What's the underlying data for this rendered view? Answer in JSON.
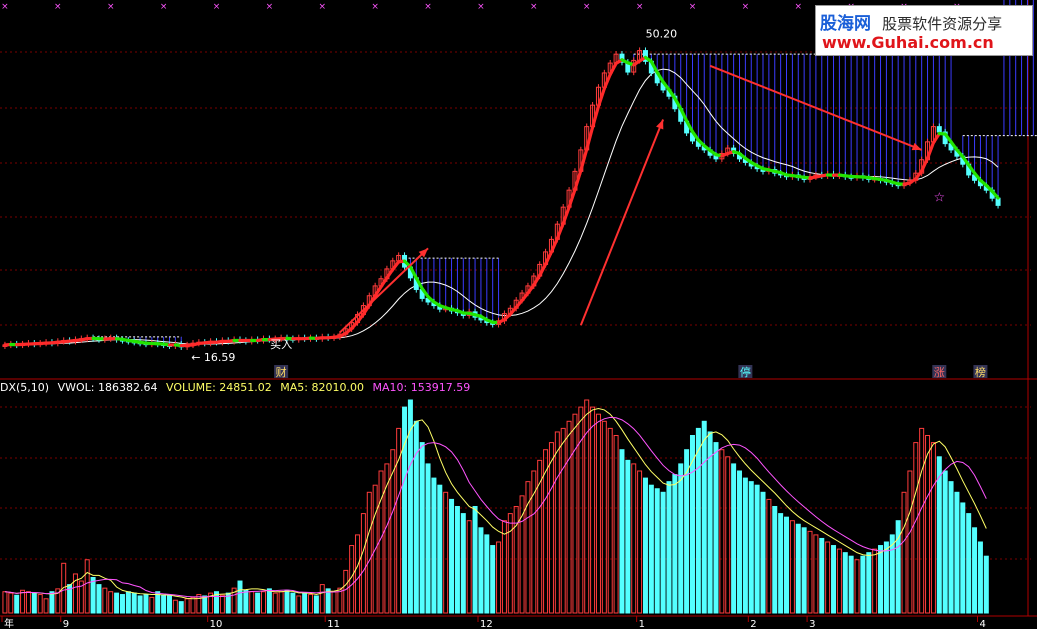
{
  "watermark": {
    "brand": "股海网",
    "subtitle": "股票软件资源分享",
    "url": "www.Guhai.com.cn"
  },
  "indicator_bar": {
    "name": "DX(5,10)",
    "vol_label": "VWOL:",
    "vol_value": "186382.64",
    "volume_label": "VOLUME:",
    "volume_value": "24851.02",
    "ma5_label": "MA5:",
    "ma5_value": "82010.00",
    "ma10_label": "MA10:",
    "ma10_value": "153917.59"
  },
  "colors": {
    "up": "#ff3c3c",
    "down": "#54ffff",
    "grid": "#7a0000",
    "ma_fast": "#ffffff",
    "ma_trend_up": "#ff2a2a",
    "ma_trend_down": "#22e400",
    "band": "#3b3bff",
    "vol_ma5": "#ffff66",
    "vol_ma10": "#ff55ff",
    "arrow": "#ff3030"
  },
  "chart_data": [
    {
      "type": "candlestick",
      "title": "",
      "y_labels": [
        "50.20",
        "16.59"
      ],
      "events": [
        {
          "label": "财",
          "index": 47
        },
        {
          "label": "停",
          "index": 126
        },
        {
          "label": "涨",
          "index": 159
        },
        {
          "label": "榜",
          "index": 166
        }
      ],
      "annotations": [
        {
          "label": "买入",
          "index": 47
        }
      ],
      "x_ticks": [
        "年",
        "9",
        "10",
        "11",
        "12",
        "1",
        "2",
        "3",
        "4"
      ],
      "x_tick_index": [
        0,
        10,
        35,
        55,
        81,
        108,
        127,
        137,
        166
      ],
      "closes": [
        16.8,
        16.9,
        16.8,
        16.9,
        17.0,
        16.9,
        17.0,
        17.1,
        17.0,
        17.2,
        17.3,
        17.2,
        17.4,
        17.5,
        17.6,
        17.5,
        17.4,
        17.5,
        17.6,
        17.4,
        17.3,
        17.2,
        17.1,
        17.0,
        16.9,
        17.0,
        16.9,
        16.8,
        16.7,
        16.9,
        16.59,
        16.8,
        17.0,
        17.1,
        17.0,
        17.2,
        17.1,
        17.3,
        17.2,
        17.4,
        17.3,
        17.2,
        17.4,
        17.3,
        17.5,
        17.4,
        17.5,
        17.6,
        17.5,
        17.4,
        17.6,
        17.5,
        17.6,
        17.5,
        17.7,
        17.6,
        17.7,
        18.0,
        18.6,
        19.3,
        20.2,
        21.2,
        22.3,
        23.4,
        24.2,
        25.3,
        26.2,
        26.8,
        25.5,
        24.3,
        23.0,
        22.0,
        21.6,
        21.2,
        20.8,
        20.9,
        20.6,
        20.4,
        20.1,
        20.5,
        19.9,
        19.6,
        19.3,
        19.1,
        19.5,
        20.3,
        20.9,
        21.8,
        22.6,
        23.4,
        24.5,
        25.8,
        27.2,
        28.6,
        30.3,
        32.2,
        34.1,
        36.2,
        38.6,
        41.2,
        43.6,
        45.6,
        47.2,
        48.3,
        49.3,
        48.4,
        47.3,
        48.6,
        49.7,
        48.5,
        47.2,
        46.1,
        45.3,
        44.6,
        43.2,
        41.8,
        40.5,
        39.6,
        39.0,
        38.6,
        38.0,
        37.6,
        38.2,
        38.8,
        38.2,
        37.6,
        37.2,
        36.8,
        36.5,
        36.2,
        36.4,
        36.0,
        35.8,
        35.6,
        35.8,
        35.5,
        35.3,
        35.6,
        35.8,
        35.7,
        35.9,
        35.7,
        35.8,
        35.6,
        35.5,
        35.7,
        35.5,
        35.3,
        35.4,
        35.2,
        35.0,
        34.8,
        34.6,
        34.9,
        35.2,
        36.0,
        37.5,
        39.5,
        41.2,
        40.6,
        39.3,
        38.6,
        37.9,
        37.0,
        35.8,
        35.2,
        34.6,
        34.1,
        33.2,
        32.4
      ],
      "opens": [
        16.7,
        16.8,
        16.9,
        16.8,
        16.9,
        17.0,
        16.9,
        17.0,
        17.1,
        17.0,
        17.2,
        17.3,
        17.2,
        17.4,
        17.5,
        17.6,
        17.5,
        17.4,
        17.5,
        17.6,
        17.4,
        17.3,
        17.2,
        17.1,
        17.0,
        16.9,
        17.0,
        16.9,
        16.8,
        16.7,
        16.9,
        16.59,
        16.8,
        17.0,
        17.1,
        17.0,
        17.2,
        17.1,
        17.3,
        17.2,
        17.4,
        17.3,
        17.2,
        17.4,
        17.3,
        17.5,
        17.4,
        17.5,
        17.6,
        17.5,
        17.4,
        17.6,
        17.5,
        17.6,
        17.5,
        17.7,
        17.6,
        17.7,
        18.0,
        18.6,
        19.3,
        20.2,
        21.2,
        22.3,
        23.4,
        24.2,
        25.3,
        26.2,
        26.8,
        25.5,
        24.3,
        23.0,
        22.0,
        21.6,
        21.2,
        20.8,
        20.9,
        20.6,
        20.4,
        20.1,
        20.5,
        19.9,
        19.6,
        19.3,
        19.1,
        19.5,
        20.3,
        20.9,
        21.8,
        22.6,
        23.4,
        24.5,
        25.8,
        27.2,
        28.6,
        30.3,
        32.2,
        34.1,
        36.2,
        38.6,
        41.2,
        43.6,
        45.6,
        47.2,
        48.3,
        49.3,
        48.4,
        47.3,
        48.6,
        49.7,
        48.5,
        47.2,
        46.1,
        45.3,
        44.6,
        43.2,
        41.8,
        40.5,
        39.6,
        39.0,
        38.6,
        38.0,
        37.6,
        38.2,
        38.8,
        38.2,
        37.6,
        37.2,
        36.8,
        36.5,
        36.2,
        36.4,
        36.0,
        35.8,
        35.6,
        35.8,
        35.5,
        35.3,
        35.6,
        35.8,
        35.7,
        35.9,
        35.7,
        35.8,
        35.6,
        35.5,
        35.7,
        35.5,
        35.3,
        35.4,
        35.2,
        35.0,
        34.8,
        34.6,
        34.9,
        35.2,
        36.0,
        37.5,
        39.5,
        41.2,
        40.6,
        39.3,
        38.6,
        37.9,
        37.0,
        35.8,
        35.2,
        34.6,
        34.1,
        33.2
      ],
      "band_segments": [
        {
          "start": 15,
          "end": 30,
          "top": 17.7
        },
        {
          "start": 68,
          "end": 84,
          "top": 26.5
        },
        {
          "start": 107,
          "end": 161,
          "top": 49.3
        },
        {
          "start": 163,
          "end": 177,
          "top": 40.2
        }
      ],
      "ma_fast_window": 3,
      "ma_slow_window": 12
    },
    {
      "type": "bar",
      "title": "",
      "series": [
        {
          "name": "VWOL",
          "values": [
            30,
            28,
            25,
            32,
            30,
            28,
            26,
            20,
            30,
            34,
            70,
            40,
            55,
            45,
            75,
            50,
            40,
            35,
            30,
            28,
            26,
            30,
            28,
            24,
            26,
            22,
            30,
            25,
            24,
            18,
            16,
            20,
            22,
            26,
            24,
            28,
            30,
            25,
            28,
            35,
            45,
            32,
            30,
            28,
            30,
            34,
            28,
            30,
            32,
            28,
            24,
            28,
            26,
            24,
            40,
            34,
            30,
            35,
            60,
            95,
            110,
            140,
            170,
            180,
            200,
            210,
            230,
            260,
            290,
            300,
            270,
            240,
            210,
            190,
            180,
            170,
            160,
            150,
            140,
            130,
            150,
            120,
            110,
            95,
            100,
            130,
            140,
            150,
            165,
            185,
            200,
            215,
            230,
            240,
            255,
            260,
            270,
            280,
            290,
            300,
            290,
            280,
            270,
            260,
            250,
            230,
            215,
            210,
            200,
            190,
            180,
            175,
            170,
            185,
            195,
            210,
            230,
            250,
            260,
            270,
            255,
            240,
            230,
            220,
            210,
            200,
            190,
            185,
            180,
            170,
            160,
            150,
            140,
            135,
            130,
            125,
            120,
            115,
            110,
            105,
            100,
            95,
            90,
            85,
            80,
            75,
            80,
            85,
            90,
            95,
            100,
            110,
            130,
            170,
            200,
            240,
            260,
            250,
            240,
            220,
            200,
            185,
            170,
            155,
            140,
            120,
            100,
            80
          ]
        },
        {
          "name": "MA5"
        },
        {
          "name": "MA10"
        }
      ]
    }
  ]
}
